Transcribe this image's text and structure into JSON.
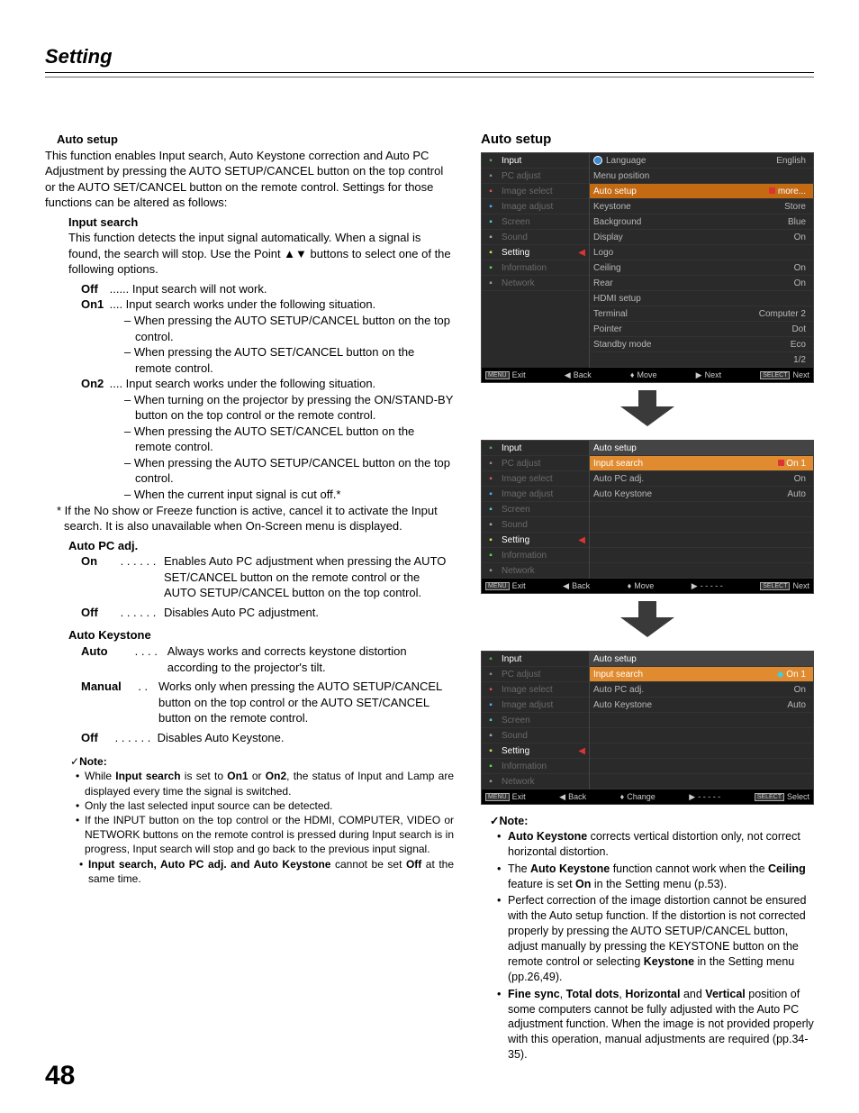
{
  "section_title": "Setting",
  "page_number": "48",
  "left": {
    "auto_setup_head": "Auto setup",
    "auto_setup_intro": "This function enables Input search, Auto Keystone correction and Auto PC Adjustment by pressing the AUTO SETUP/CANCEL button on the top control or the AUTO SET/CANCEL button on the remote control. Settings for those functions can be altered as follows:",
    "input_search_head": "Input search",
    "input_search_desc": "This function detects the input signal automatically. When a signal is found, the search will stop. Use the Point ▲▼ buttons to select one of the following options.",
    "off_label": "Off",
    "off_dots": " ...... ",
    "off_desc": "Input search will not work.",
    "on1_label": "On1",
    "on1_dots": " .... ",
    "on1_desc": "Input search works under the following situation.",
    "on1_b1": "– When pressing the AUTO SETUP/CANCEL button on the top control.",
    "on1_b2": "– When pressing the AUTO SET/CANCEL button on the remote control.",
    "on2_label": "On2",
    "on2_dots": " .... ",
    "on2_desc": "Input search works under the following situation.",
    "on2_b1": "– When turning on the projector by pressing the ON/STAND-BY button on the top control or the remote control.",
    "on2_b2": "– When pressing the AUTO SET/CANCEL button on the remote control.",
    "on2_b3": "– When pressing the AUTO SETUP/CANCEL button on the top control.",
    "on2_b4": "–  When the current input signal is cut off.*",
    "star_note": "* If the No show or Freeze function is active, cancel it to activate the Input search. It is also unavailable when On-Screen menu is displayed.",
    "autopc_head": "Auto PC adj.",
    "autopc_on_label": "On",
    "autopc_on_dots": " . . . . . .  ",
    "autopc_on_desc": "Enables Auto PC adjustment when pressing the AUTO SET/CANCEL button on the remote control or the AUTO SETUP/CANCEL button on the top control.",
    "autopc_off_label": "Off",
    "autopc_off_dots": " . . . . . .  ",
    "autopc_off_desc": "Disables Auto PC adjustment.",
    "autok_head": "Auto Keystone",
    "ak_auto_label": "Auto",
    "ak_auto_dots": " . . . .   ",
    "ak_auto_desc": "Always works and corrects keystone distortion according to the projector's tilt.",
    "ak_manual_label": "Manual",
    "ak_manual_dots": "  . .  ",
    "ak_manual_desc": "Works only when pressing the AUTO SETUP/CANCEL button on the top control or the AUTO SET/CANCEL button on the remote control.",
    "ak_off_label": "Off",
    "ak_off_dots": " . . . . . .  ",
    "ak_off_desc": "Disables Auto Keystone.",
    "note_head": "Note:",
    "note1_pre": "While ",
    "note1_b1": "Input search",
    "note1_mid1": " is set to ",
    "note1_b2": "On1",
    "note1_mid2": " or ",
    "note1_b3": "On2",
    "note1_post": ", the status of Input and Lamp are displayed every time the signal is switched.",
    "note2": "Only the last selected input source can be detected.",
    "note3": "If the INPUT button on the top control or the  HDMI, COMPUTER, VIDEO or NETWORK buttons on the remote control is pressed during Input search is in progress, Input search will stop and go back to the previous input signal.",
    "note4_b": "Input search, Auto PC adj. and Auto Keystone",
    "note4_mid": " cannot be set ",
    "note4_b2": "Off",
    "note4_post": " at the same time."
  },
  "right": {
    "title": "Auto setup",
    "menu_items": {
      "input": "Input",
      "pc_adjust": "PC adjust",
      "image_select": "Image select",
      "image_adjust": "Image adjust",
      "screen": "Screen",
      "sound": "Sound",
      "setting": "Setting",
      "information": "Information",
      "network": "Network"
    },
    "panel1_rows": [
      {
        "l": "Language",
        "r": "English",
        "globe": true
      },
      {
        "l": "Menu position",
        "r": ""
      },
      {
        "l": "Auto setup",
        "r": "more...",
        "hl": true,
        "dot": true
      },
      {
        "l": "Keystone",
        "r": "Store"
      },
      {
        "l": "Background",
        "r": "Blue"
      },
      {
        "l": "Display",
        "r": "On"
      },
      {
        "l": "Logo",
        "r": ""
      },
      {
        "l": "Ceiling",
        "r": "On"
      },
      {
        "l": "Rear",
        "r": "On"
      },
      {
        "l": "HDMI setup",
        "r": ""
      },
      {
        "l": "Terminal",
        "r": "Computer 2"
      },
      {
        "l": "Pointer",
        "r": "Dot"
      },
      {
        "l": "Standby mode",
        "r": "Eco"
      }
    ],
    "panel1_page": "1/2",
    "panel2_head": "Auto setup",
    "panel2_rows": [
      {
        "l": "Input search",
        "r": "On 1",
        "hl": true,
        "dot": true
      },
      {
        "l": "Auto PC adj.",
        "r": "On"
      },
      {
        "l": "Auto Keystone",
        "r": "Auto"
      }
    ],
    "panel3_head": "Auto setup",
    "panel3_rows": [
      {
        "l": "Input search",
        "r": "On 1",
        "hl": true,
        "tri": true
      },
      {
        "l": "Auto PC adj.",
        "r": "On"
      },
      {
        "l": "Auto Keystone",
        "r": "Auto"
      }
    ],
    "footer": {
      "menu": "MENU",
      "exit": "Exit",
      "back": "Back",
      "move": "Move",
      "change": "Change",
      "next_tri": "Next",
      "dashes": "- - - - -",
      "select_box": "SELECT",
      "next": "Next",
      "select": "Select"
    },
    "notes_head": "Note:",
    "note1_b": "Auto Keystone",
    "note1_post": " corrects vertical distortion only, not correct horizontal distortion.",
    "note2_pre": "The ",
    "note2_b1": "Auto Keystone",
    "note2_mid1": " function cannot work when the ",
    "note2_b2": "Ceiling",
    "note2_mid2": " feature is set ",
    "note2_b3": "On",
    "note2_post": " in the Setting menu (p.53).",
    "note3_pre": "Perfect correction of the image distortion cannot be ensured with the Auto setup function. If the distortion is not corrected properly by pressing the AUTO SETUP/CANCEL button, adjust manually by pressing the KEYSTONE button on the remote control or selecting ",
    "note3_b": "Keystone",
    "note3_post": " in the Setting menu (pp.26,49).",
    "note4_b1": "Fine sync",
    "note4_c": ", ",
    "note4_b2": "Total dots",
    "note4_b3": "Horizontal",
    "note4_and": " and ",
    "note4_b4": "Vertical",
    "note4_post": " position of some computers cannot be fully adjusted with the Auto PC adjustment function. When the image is not provided properly with this operation, manual adjustments are required (pp.34-35)."
  }
}
